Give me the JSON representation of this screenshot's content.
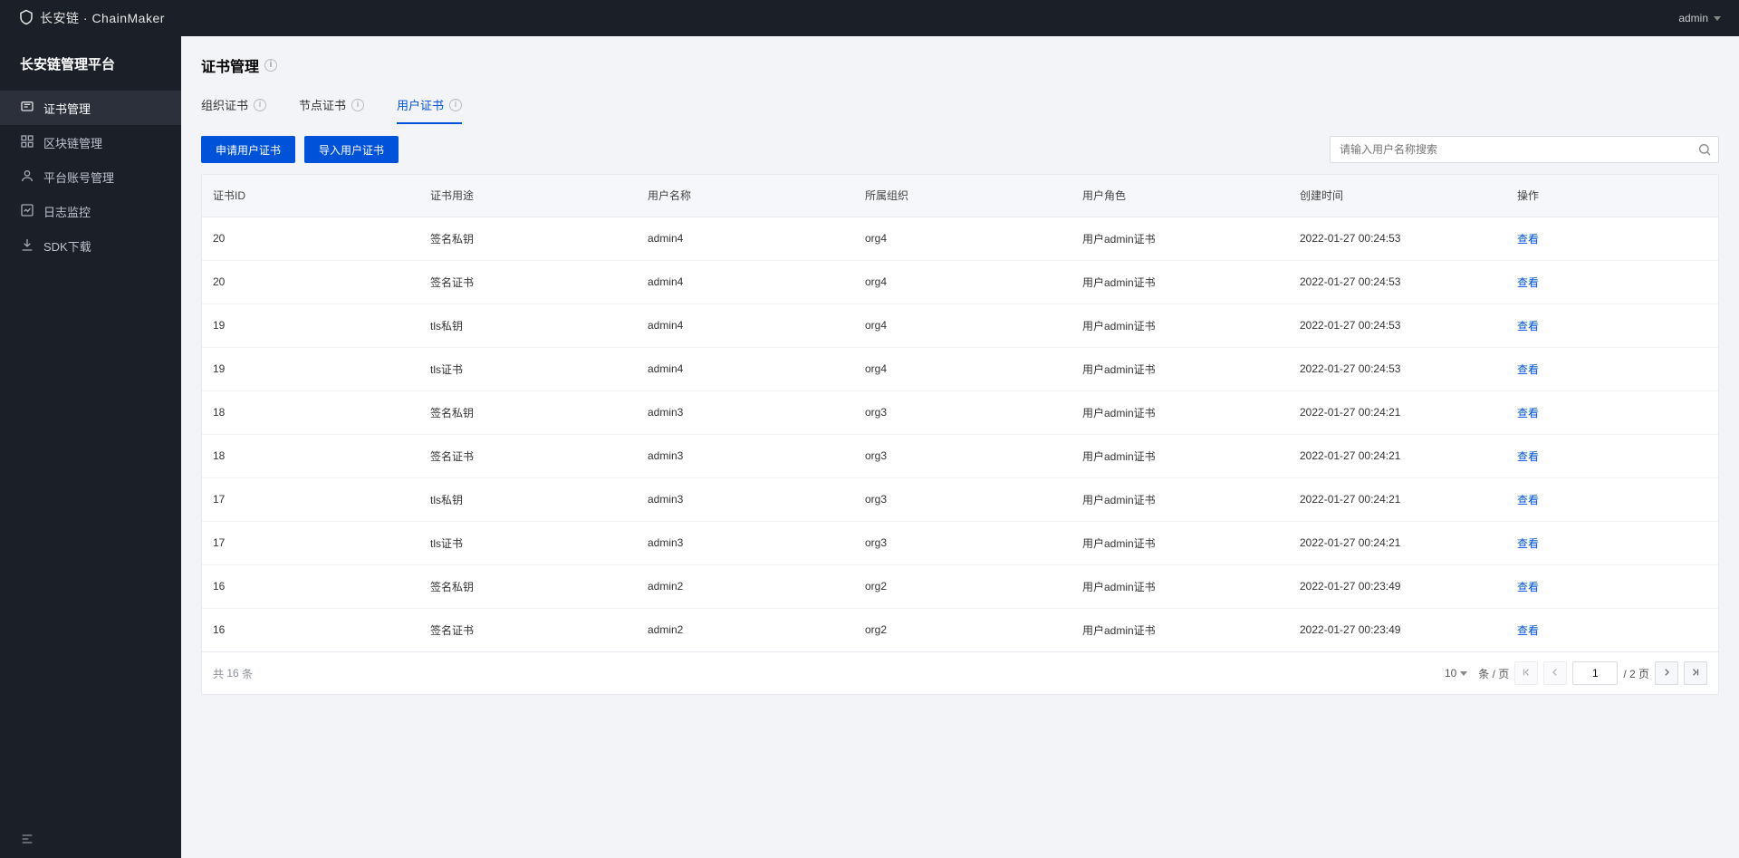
{
  "brand": "长安链 · ChainMaker",
  "user": {
    "name": "admin"
  },
  "sidebar": {
    "title": "长安链管理平台",
    "items": [
      {
        "label": "证书管理",
        "icon": "cert"
      },
      {
        "label": "区块链管理",
        "icon": "chain"
      },
      {
        "label": "平台账号管理",
        "icon": "user"
      },
      {
        "label": "日志监控",
        "icon": "log"
      },
      {
        "label": "SDK下载",
        "icon": "download"
      }
    ]
  },
  "page": {
    "title": "证书管理"
  },
  "tabs": {
    "items": [
      {
        "label": "组织证书"
      },
      {
        "label": "节点证书"
      },
      {
        "label": "用户证书"
      }
    ],
    "activeIndex": 2
  },
  "toolbar": {
    "apply_label": "申请用户证书",
    "import_label": "导入用户证书",
    "search_placeholder": "请输入用户名称搜索"
  },
  "table": {
    "columns": [
      "证书ID",
      "证书用途",
      "用户名称",
      "所属组织",
      "用户角色",
      "创建时间",
      "操作"
    ],
    "action_label": "查看",
    "rows": [
      {
        "id": "20",
        "usage": "签名私钥",
        "user": "admin4",
        "org": "org4",
        "role": "用户admin证书",
        "created": "2022-01-27 00:24:53"
      },
      {
        "id": "20",
        "usage": "签名证书",
        "user": "admin4",
        "org": "org4",
        "role": "用户admin证书",
        "created": "2022-01-27 00:24:53"
      },
      {
        "id": "19",
        "usage": "tls私钥",
        "user": "admin4",
        "org": "org4",
        "role": "用户admin证书",
        "created": "2022-01-27 00:24:53"
      },
      {
        "id": "19",
        "usage": "tls证书",
        "user": "admin4",
        "org": "org4",
        "role": "用户admin证书",
        "created": "2022-01-27 00:24:53"
      },
      {
        "id": "18",
        "usage": "签名私钥",
        "user": "admin3",
        "org": "org3",
        "role": "用户admin证书",
        "created": "2022-01-27 00:24:21"
      },
      {
        "id": "18",
        "usage": "签名证书",
        "user": "admin3",
        "org": "org3",
        "role": "用户admin证书",
        "created": "2022-01-27 00:24:21"
      },
      {
        "id": "17",
        "usage": "tls私钥",
        "user": "admin3",
        "org": "org3",
        "role": "用户admin证书",
        "created": "2022-01-27 00:24:21"
      },
      {
        "id": "17",
        "usage": "tls证书",
        "user": "admin3",
        "org": "org3",
        "role": "用户admin证书",
        "created": "2022-01-27 00:24:21"
      },
      {
        "id": "16",
        "usage": "签名私钥",
        "user": "admin2",
        "org": "org2",
        "role": "用户admin证书",
        "created": "2022-01-27 00:23:49"
      },
      {
        "id": "16",
        "usage": "签名证书",
        "user": "admin2",
        "org": "org2",
        "role": "用户admin证书",
        "created": "2022-01-27 00:23:49"
      }
    ]
  },
  "pagination": {
    "total_prefix": "共",
    "total": "16",
    "total_suffix": "条",
    "page_size": "10",
    "per_page_label": "条 / 页",
    "current_page": "1",
    "total_pages_label": "/ 2 页"
  }
}
